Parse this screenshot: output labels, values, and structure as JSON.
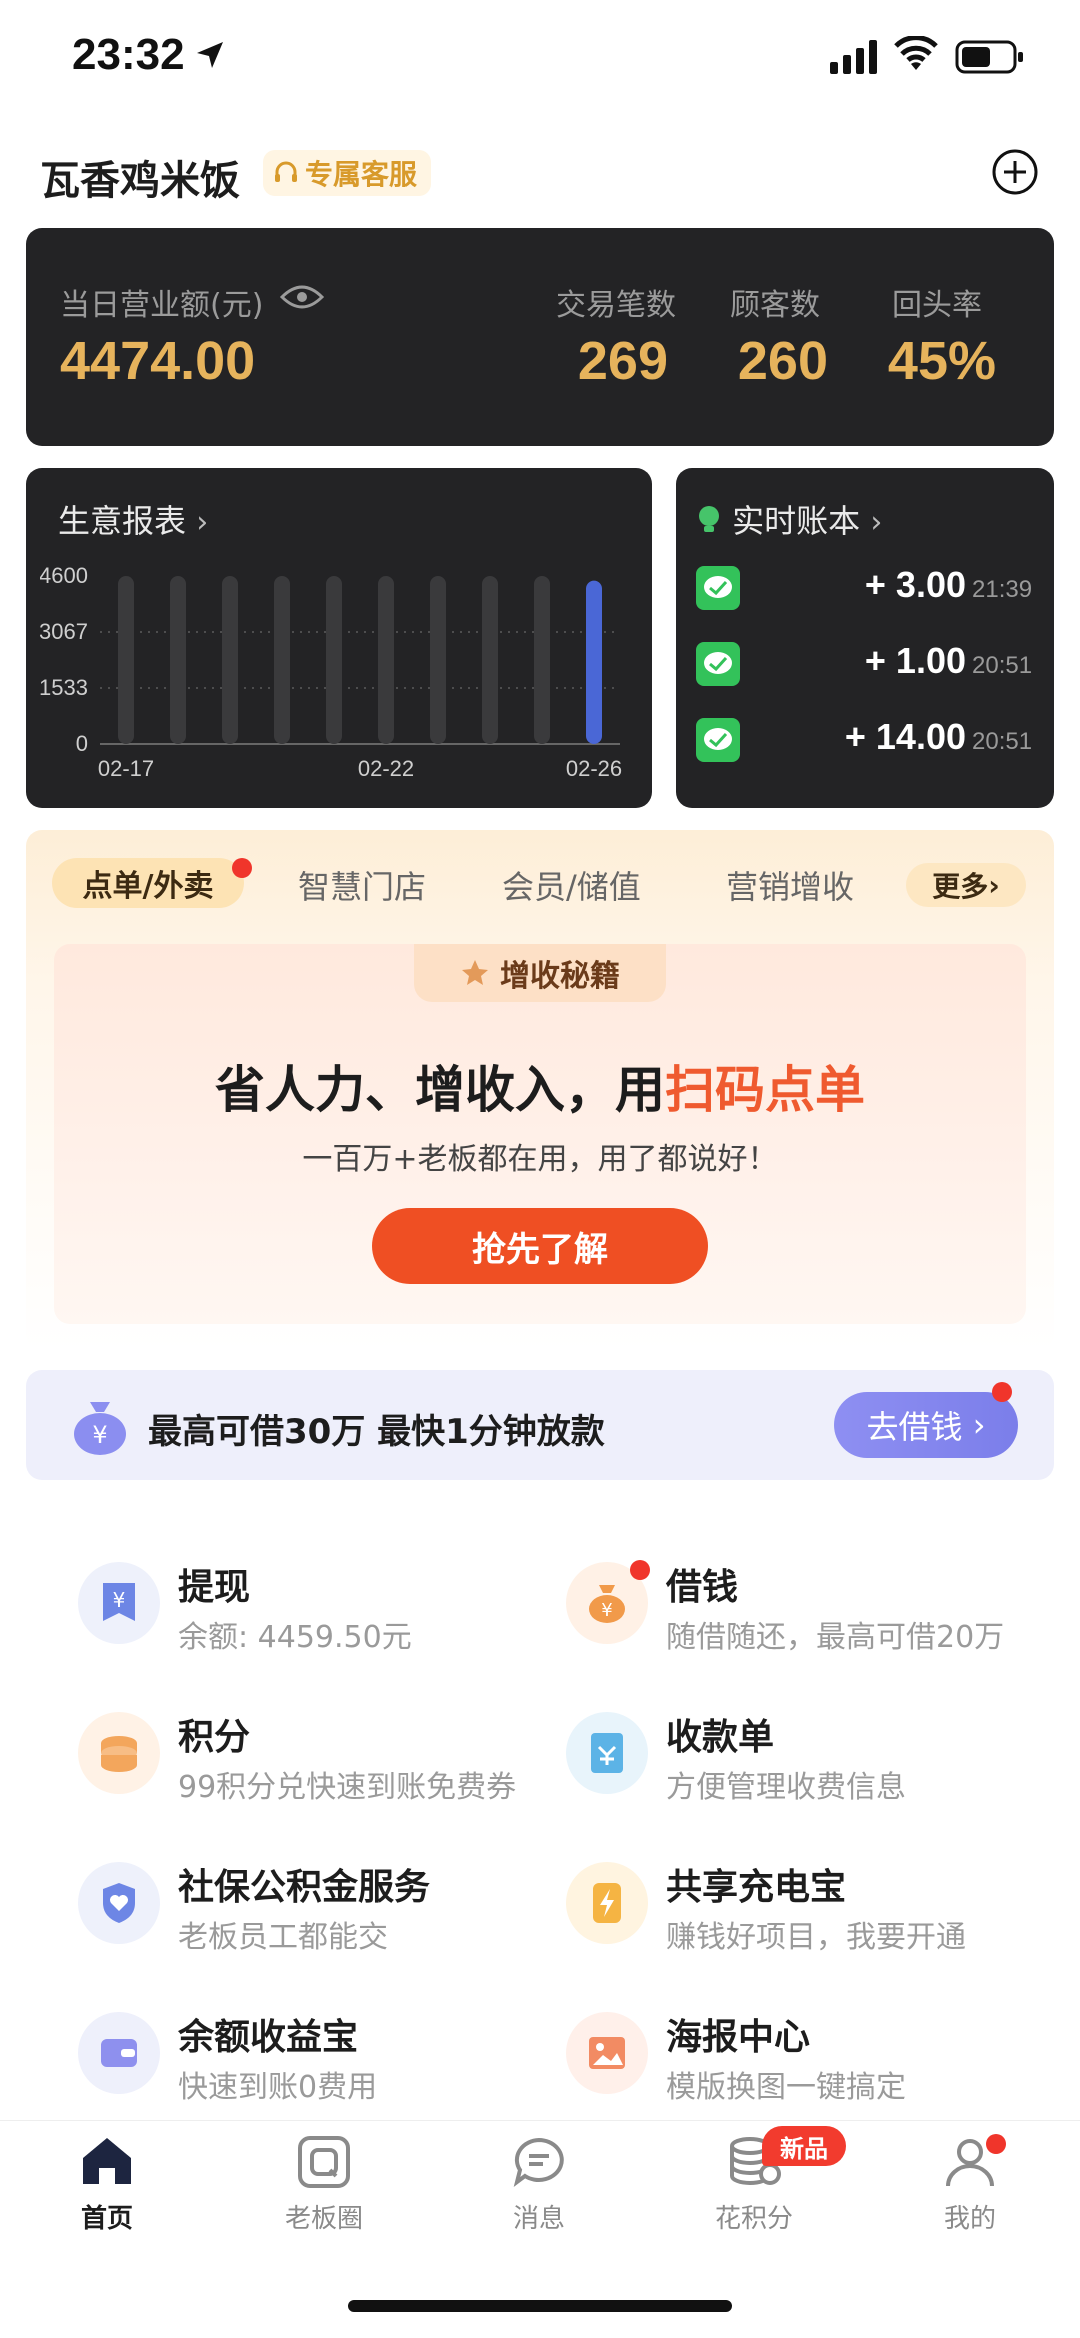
{
  "status_bar": {
    "time": "23:32"
  },
  "header": {
    "store_name": "瓦香鸡米饭",
    "service_label": "专属客服"
  },
  "revenue": {
    "label": "当日营业额(元)",
    "value": "4474.00",
    "stats": [
      {
        "label": "交易笔数",
        "value": "269"
      },
      {
        "label": "顾客数",
        "value": "260"
      },
      {
        "label": "回头率",
        "value": "45%"
      }
    ]
  },
  "report": {
    "title": "生意报表"
  },
  "chart_data": {
    "type": "bar",
    "categories": [
      "02-17",
      "02-18",
      "02-19",
      "02-20",
      "02-21",
      "02-22",
      "02-23",
      "02-24",
      "02-25",
      "02-26"
    ],
    "x_tick_labels": [
      "02-17",
      "02-22",
      "02-26"
    ],
    "y_ticks": [
      "4600",
      "3067",
      "1533",
      "0"
    ],
    "values": [
      4600,
      4600,
      4600,
      4600,
      4600,
      4600,
      4600,
      4600,
      4600,
      4474
    ],
    "ylim": [
      0,
      4600
    ],
    "highlight_index": 9,
    "colors": {
      "bar": "#3a3a3c",
      "highlight": "#4a67d6"
    }
  },
  "ledger": {
    "title": "实时账本",
    "rows": [
      {
        "amount": "+ 3.00",
        "time": "21:39"
      },
      {
        "amount": "+ 1.00",
        "time": "20:51"
      },
      {
        "amount": "+ 14.00",
        "time": "20:51"
      }
    ]
  },
  "tabs": {
    "active": "点单/外卖",
    "items": [
      "智慧门店",
      "会员/储值",
      "营销增收"
    ],
    "more": "更多"
  },
  "promo": {
    "ribbon": "增收秘籍",
    "title_main": "省人力、增收入，用",
    "title_highlight": "扫码点单",
    "subtitle": "一百万+老板都在用，用了都说好！",
    "button": "抢先了解"
  },
  "loan": {
    "text": "最高可借30万 最快1分钟放款",
    "button": "去借钱"
  },
  "services": [
    {
      "title": "提现",
      "sub": "余额: 4459.50元",
      "icon": "withdraw-icon"
    },
    {
      "title": "借钱",
      "sub": "随借随还，最高可借20万",
      "icon": "money-bag-icon"
    },
    {
      "title": "积分",
      "sub": "99积分兑快速到账免费券",
      "icon": "coins-icon"
    },
    {
      "title": "收款单",
      "sub": "方便管理收费信息",
      "icon": "receipt-icon"
    },
    {
      "title": "社保公积金服务",
      "sub": "老板员工都能交",
      "icon": "shield-icon"
    },
    {
      "title": "共享充电宝",
      "sub": "赚钱好项目，我要开通",
      "icon": "lightning-icon"
    },
    {
      "title": "余额收益宝",
      "sub": "快速到账0费用",
      "icon": "wallet-icon"
    },
    {
      "title": "海报中心",
      "sub": "模版换图一键搞定",
      "icon": "image-icon"
    }
  ],
  "tabbar": {
    "items": [
      "首页",
      "老板圈",
      "消息",
      "花积分",
      "我的"
    ],
    "new_badge": "新品"
  }
}
